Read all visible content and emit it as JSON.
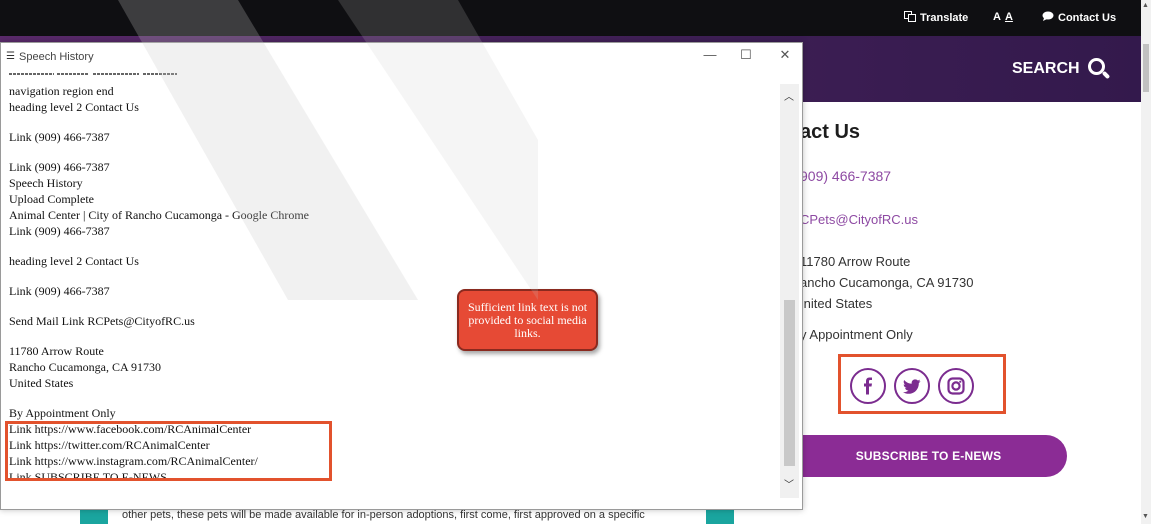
{
  "site": {
    "topbar": {
      "translate": "Translate",
      "text_size": "A",
      "text_size_underlined": "A",
      "contact": "Contact Us"
    },
    "search_label": "SEARCH",
    "contact": {
      "heading": "act Us",
      "phone": "909) 466-7387",
      "email": "CPets@CityofRC.us",
      "address": [
        "11780 Arrow Route",
        "ancho Cucamonga, CA 91730",
        "Inited States"
      ],
      "appointment": "y Appointment Only"
    },
    "social": {
      "facebook": "f",
      "twitter": "t",
      "instagram": "ig"
    },
    "subscribe": "SUBSCRIBE TO E-NEWS",
    "bottom_text": "other pets, these pets will be made available for in-person adoptions, first come, first approved on a specific"
  },
  "window": {
    "title": "Speech History",
    "controls": {
      "minimize": "—",
      "maximize": "☐",
      "close": "✕"
    },
    "lines": [
      "navigation region end",
      "heading level 2 Contact Us",
      "",
      "Link (909) 466-7387",
      "",
      "Link (909) 466-7387",
      "Speech History",
      "Upload Complete",
      "Animal Center | City of Rancho Cucamonga - Google Chrome",
      "Link (909) 466-7387",
      "",
      "heading level 2 Contact Us",
      "",
      "Link (909) 466-7387",
      "",
      "Send Mail Link RCPets@CityofRC.us",
      "",
      "11780 Arrow Route",
      "Rancho Cucamonga, CA 91730",
      "United States",
      "",
      "By Appointment Only",
      "Link https://www.facebook.com/RCAnimalCenter",
      "Link https://twitter.com/RCAnimalCenter",
      "Link https://www.instagram.com/RCAnimalCenter/",
      "Link SUBSCRIBE TO E-NEWS"
    ]
  },
  "callout": {
    "text": "Sufficient link text is not provided to social media links."
  },
  "colors": {
    "accent_purple": "#8b2c95",
    "highlight_red": "#e2522d",
    "callout_fill": "#e64a35",
    "teal": "#1aa59f"
  }
}
